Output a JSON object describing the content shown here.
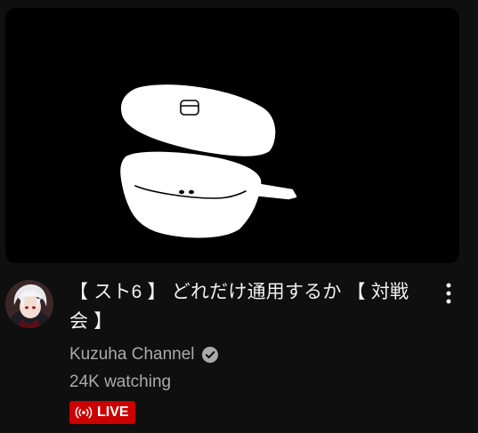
{
  "video": {
    "title": "【 スト6 】 どれだけ通用するか 【 対戦会 】",
    "channel_name": "Kuzuha Channel",
    "channel_verified": true,
    "viewers": "24K watching",
    "live_label": "LIVE",
    "thumbnail": "white line drawing of a lidded pot on black background"
  },
  "icons": {
    "verified": "verified-check-icon",
    "menu": "more-vert-icon",
    "live": "broadcast-icon"
  },
  "colors": {
    "background": "#0f0f0f",
    "title": "#f1f1f1",
    "secondary_text": "#aaaaaa",
    "live_badge": "#cc0000"
  }
}
